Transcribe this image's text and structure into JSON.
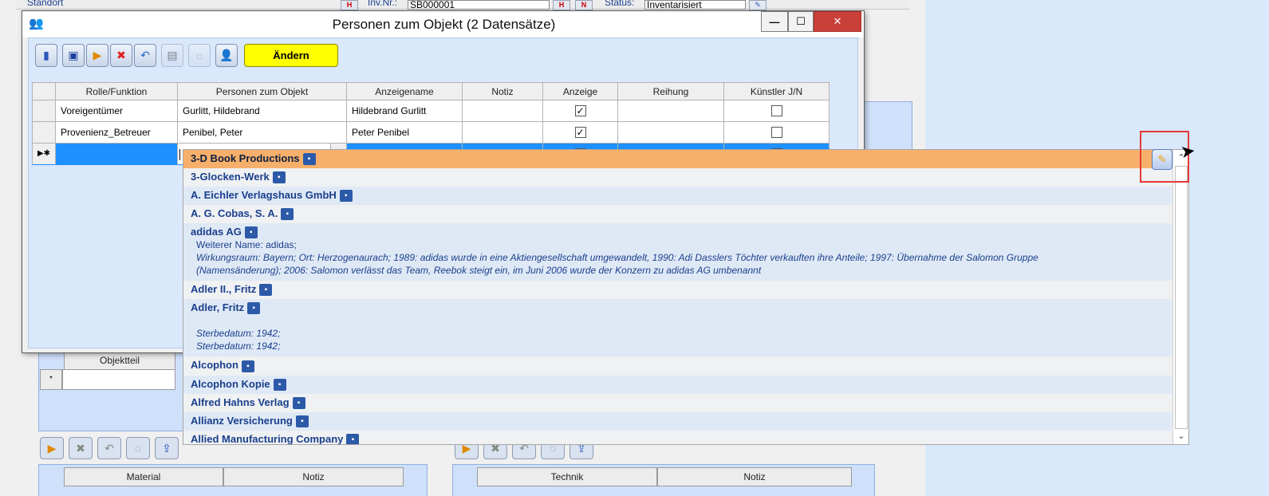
{
  "background": {
    "labels": {
      "standort": "Standort",
      "invnr": "Inv.Nr.:",
      "invnr_value": "SB000001",
      "status": "Status:",
      "status_value": "Inventarisiert"
    },
    "objektteil_header": "Objektteil",
    "material_grid": {
      "col1": "Material",
      "col2": "Notiz"
    },
    "technik_grid": {
      "col1": "Technik",
      "col2": "Notiz"
    }
  },
  "dialog": {
    "title": "Personen zum Objekt (2 Datensätze)",
    "toolbar": {
      "aendern_label": "Ändern"
    },
    "grid": {
      "headers": [
        "Rolle/Funktion",
        "Personen zum Objekt",
        "Anzeigename",
        "Notiz",
        "Anzeige",
        "Reihung",
        "Künstler J/N"
      ],
      "rows": [
        {
          "rolle": "Voreigentümer",
          "person": "Gurlitt, Hildebrand",
          "anzeigename": "Hildebrand Gurlitt",
          "notiz": "",
          "anzeige": true,
          "reihung": "",
          "kuenstler": false
        },
        {
          "rolle": "Provenienz_Betreuer",
          "person": "Penibel, Peter",
          "anzeigename": "Peter Penibel",
          "notiz": "",
          "anzeige": true,
          "reihung": "",
          "kuenstler": false
        }
      ],
      "new_row": {
        "anzeige": false,
        "kuenstler": false
      }
    }
  },
  "dropdown": {
    "items": [
      {
        "name": "3-D Book Productions"
      },
      {
        "name": "3-Glocken-Werk"
      },
      {
        "name": "A. Eichler Verlagshaus GmbH"
      },
      {
        "name": "A. G. Cobas, S. A."
      },
      {
        "name": "adidas AG",
        "desc_line1": "Weiterer Name: adidas;",
        "desc_line2": "Wirkungsraum: Bayern; Ort: Herzogenaurach; 1989: adidas wurde in eine Aktiengesellschaft umgewandelt, 1990: Adi Dasslers Töchter verkauften ihre Anteile; 1997: Übernahme der Salomon Gruppe",
        "desc_line3": "(Namensänderung); 2006: Salomon verlässt das Team, Reebok steigt ein, im Juni 2006 wurde der Konzern zu adidas AG umbenannt"
      },
      {
        "name": "Adler II., Fritz"
      },
      {
        "name": "Adler, Fritz",
        "desc_line1": "Sterbedatum: 1942;",
        "desc_line2": "Sterbedatum: 1942;"
      },
      {
        "name": "Alcophon"
      },
      {
        "name": "Alcophon Kopie"
      },
      {
        "name": "Alfred Hahns Verlag"
      },
      {
        "name": "Allianz Versicherung"
      },
      {
        "name": "Allied Manufacturing Company"
      }
    ]
  },
  "icons": {
    "app_icon": "people-icon",
    "toolbar": [
      "exit-icon",
      "save-icon",
      "new-record-icon",
      "delete-icon",
      "undo-icon",
      "print-icon",
      "comment-icon",
      "person-icon"
    ],
    "item_icon": "contact-card-icon",
    "corner_button": "edit-pencil-icon"
  },
  "colors": {
    "highlight_row": "#f7b06b",
    "active_row": "#1e90ff",
    "aendern_button": "#ffff00",
    "close_button": "#c94039",
    "link_text": "#1a3f8c"
  }
}
